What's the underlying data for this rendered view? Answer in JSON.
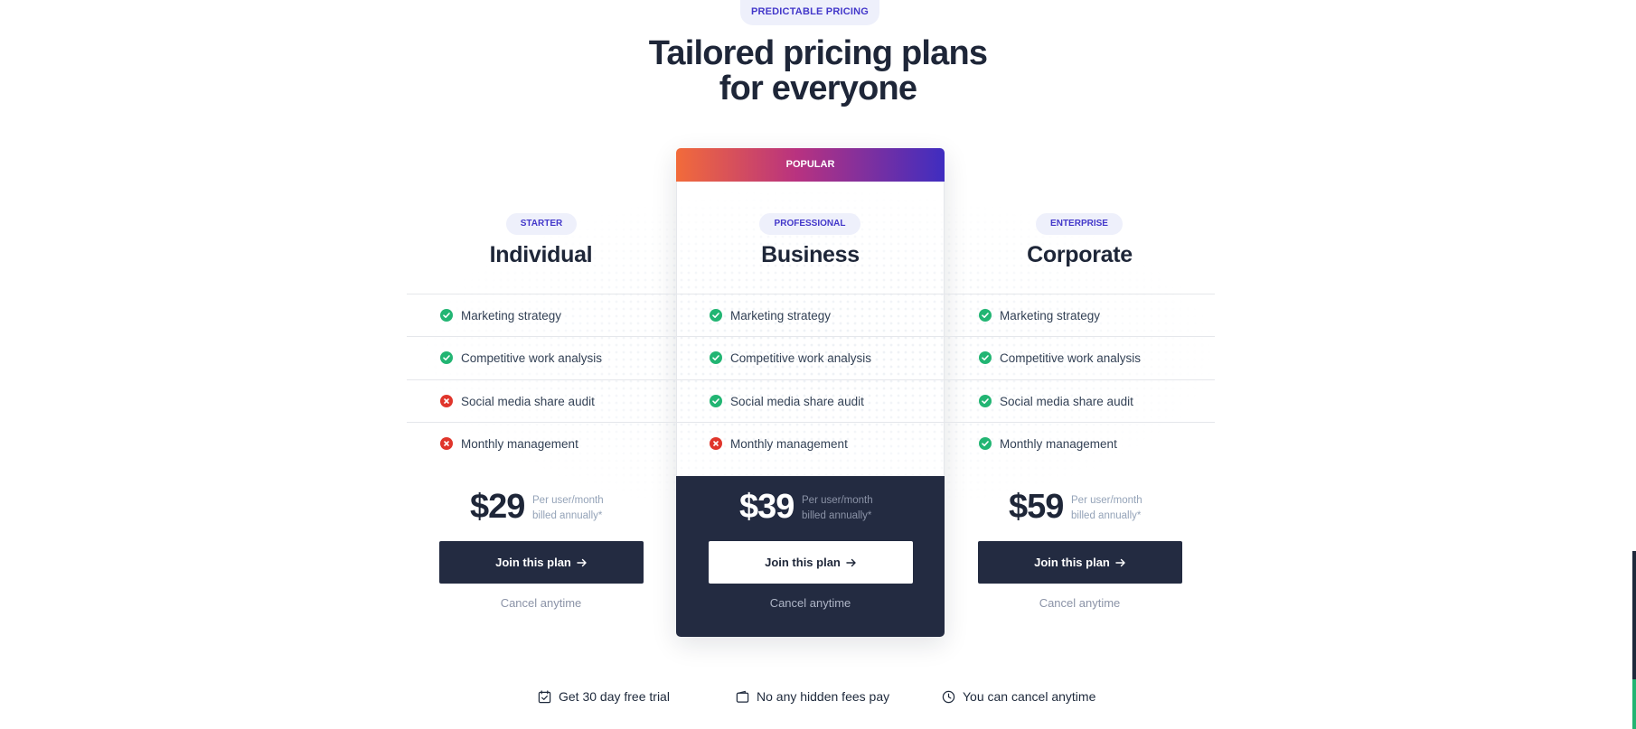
{
  "header": {
    "eyebrow": "PREDICTABLE PRICING",
    "title_line1": "Tailored pricing plans",
    "title_line2": "for everyone"
  },
  "popular_label": "POPULAR",
  "plans": [
    {
      "badge": "STARTER",
      "name": "Individual",
      "features": [
        {
          "label": "Marketing strategy",
          "included": true,
          "icon": "check-circle-icon"
        },
        {
          "label": "Competitive work analysis",
          "included": true,
          "icon": "check-circle-icon"
        },
        {
          "label": "Social media share audit",
          "included": false,
          "icon": "x-circle-icon"
        },
        {
          "label": "Monthly management",
          "included": false,
          "icon": "x-circle-icon"
        }
      ],
      "price": "$29",
      "price_note_1": "Per user/month",
      "price_note_2": "billed annually*",
      "cta": "Join this plan",
      "cancel": "Cancel anytime"
    },
    {
      "badge": "PROFESSIONAL",
      "name": "Business",
      "features": [
        {
          "label": "Marketing strategy",
          "included": true,
          "icon": "check-circle-icon"
        },
        {
          "label": "Competitive work analysis",
          "included": true,
          "icon": "check-circle-icon"
        },
        {
          "label": "Social media share audit",
          "included": true,
          "icon": "check-circle-icon"
        },
        {
          "label": "Monthly management",
          "included": false,
          "icon": "x-circle-icon"
        }
      ],
      "price": "$39",
      "price_note_1": "Per user/month",
      "price_note_2": "billed annually*",
      "cta": "Join this plan",
      "cancel": "Cancel anytime"
    },
    {
      "badge": "ENTERPRISE",
      "name": "Corporate",
      "features": [
        {
          "label": "Marketing strategy",
          "included": true,
          "icon": "check-circle-icon"
        },
        {
          "label": "Competitive work analysis",
          "included": true,
          "icon": "check-circle-icon"
        },
        {
          "label": "Social media share audit",
          "included": true,
          "icon": "check-circle-icon"
        },
        {
          "label": "Monthly management",
          "included": true,
          "icon": "check-circle-icon"
        }
      ],
      "price": "$59",
      "price_note_1": "Per user/month",
      "price_note_2": "billed annually*",
      "cta": "Join this plan",
      "cancel": "Cancel anytime"
    }
  ],
  "perks": [
    {
      "icon": "calendar-check-icon",
      "label": "Get 30 day free trial"
    },
    {
      "icon": "wallet-icon",
      "label": "No any hidden fees pay"
    },
    {
      "icon": "clock-icon",
      "label": "You can cancel anytime"
    }
  ],
  "colors": {
    "navy": "#232b41",
    "accent_indigo": "#4338ca",
    "check_green": "#22b573",
    "cross_red": "#e0352b",
    "gradient_start": "#f26b3a",
    "gradient_end": "#3f2dc0"
  }
}
